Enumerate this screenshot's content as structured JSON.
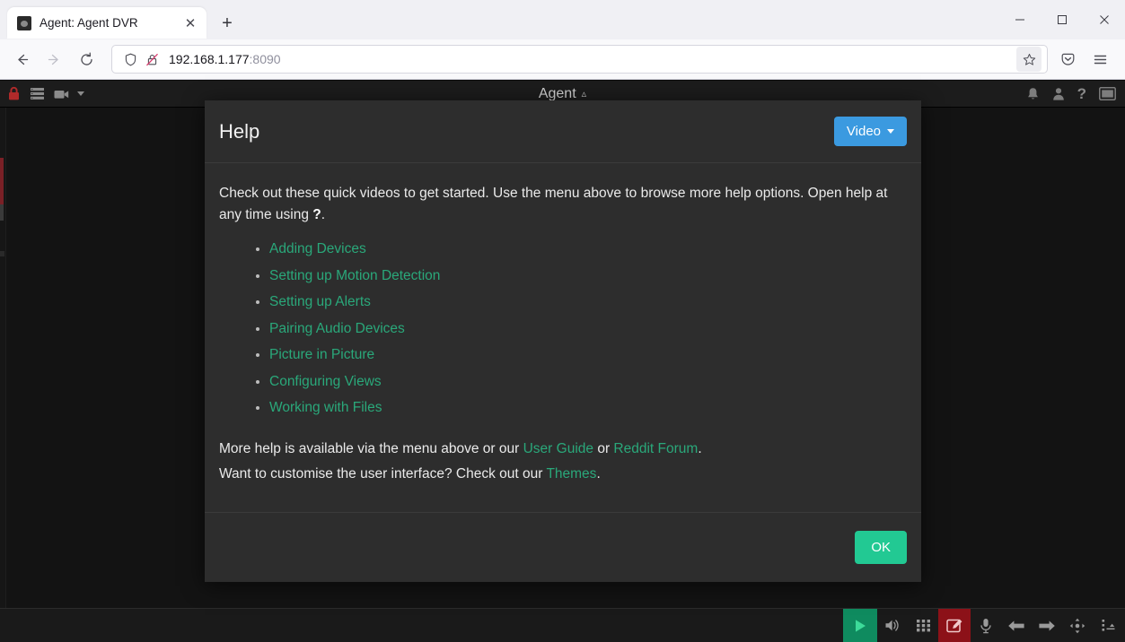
{
  "browser": {
    "tab": {
      "title": "Agent: Agent DVR",
      "favicon_name": "agent-dvr-favicon",
      "close_label": "✕"
    },
    "newtab_label": "+",
    "window_controls": {
      "minimize": "minimize-icon",
      "maximize": "maximize-icon",
      "close": "close-icon"
    },
    "nav": {
      "back": "back-arrow-icon",
      "forward": "forward-arrow-icon",
      "reload": "reload-icon",
      "shield": "shield-icon",
      "lock": "insecure-lock-icon",
      "url_host": "192.168.1.177",
      "url_port": ":8090",
      "bookmark": "star-icon",
      "pocket": "pocket-icon",
      "menu": "hamburger-menu-icon"
    }
  },
  "app": {
    "header": {
      "lock_icon": "red-lock-icon",
      "server_icon": "server-list-icon",
      "camera_icon": "camera-icon",
      "camera_caret": "chevron-down-icon",
      "title": "Agent",
      "title_caret": "˄",
      "alerts_icon": "bell-icon",
      "user_icon": "user-icon",
      "help_icon": "question-mark-icon",
      "layout_icon": "window-layout-icon",
      "help_label": "?"
    },
    "bottombar": {
      "buttons": [
        {
          "name": "play-button",
          "glyph": "play-icon"
        },
        {
          "name": "volume-button",
          "glyph": "speaker-icon"
        },
        {
          "name": "grid-button",
          "glyph": "grid-icon"
        },
        {
          "name": "record-button",
          "glyph": "edit-record-icon"
        },
        {
          "name": "microphone-button",
          "glyph": "microphone-icon"
        },
        {
          "name": "previous-button",
          "glyph": "arrow-left-icon"
        },
        {
          "name": "next-button",
          "glyph": "arrow-right-icon"
        },
        {
          "name": "ptz-button",
          "glyph": "move-arrows-icon"
        },
        {
          "name": "more-button",
          "glyph": "more-options-icon"
        }
      ]
    }
  },
  "modal": {
    "title": "Help",
    "video_button": "Video",
    "intro_part1": "Check out these quick videos to get started. Use the menu above to browse more help options. Open help at any time using ",
    "intro_help_symbol": "?",
    "intro_part2": ".",
    "links": [
      "Adding Devices",
      "Setting up Motion Detection",
      "Setting up Alerts",
      "Pairing Audio Devices",
      "Picture in Picture",
      "Configuring Views",
      "Working with Files"
    ],
    "footer_line1_prefix": "More help is available via the menu above or our ",
    "footer_link_user_guide": "User Guide",
    "footer_line1_mid": " or ",
    "footer_link_reddit": "Reddit Forum",
    "footer_line1_suffix": ".",
    "footer_line2_prefix": "Want to customise the user interface? Check out our ",
    "footer_link_themes": "Themes",
    "footer_line2_suffix": ".",
    "ok_button": "OK"
  },
  "colors": {
    "accent_blue": "#3b9ae0",
    "accent_green": "#22c993",
    "link_green": "#2aa87a",
    "record_red": "#8c1118",
    "modal_bg": "#2d2d2d",
    "app_bg": "#131313"
  }
}
